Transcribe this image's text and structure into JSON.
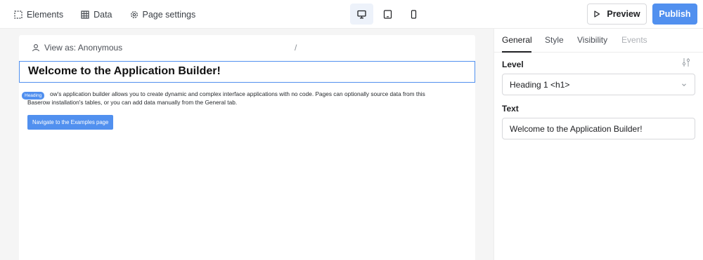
{
  "toolbar": {
    "elements_label": "Elements",
    "data_label": "Data",
    "page_settings_label": "Page settings",
    "preview_label": "Preview",
    "publish_label": "Publish"
  },
  "devices": [
    {
      "name": "desktop",
      "active": true
    },
    {
      "name": "tablet",
      "active": false
    },
    {
      "name": "smartphone",
      "active": false
    }
  ],
  "page": {
    "view_as_label": "View as: Anonymous",
    "path": "/",
    "heading": "Welcome to the Application Builder!",
    "heading_badge": "Heading",
    "paragraph_line1": "ow's application builder allows you to create dynamic and complex interface applications with no code. Pages can optionally source data from this",
    "paragraph_line2": "Baserow installation's tables, or you can add data manually from the General tab.",
    "button_label": "Navigate to the Examples page"
  },
  "panel": {
    "tabs": [
      "General",
      "Style",
      "Visibility",
      "Events"
    ],
    "active_tab": "General",
    "level_label": "Level",
    "level_value": "Heading 1 <h1>",
    "text_label": "Text",
    "text_value": "Welcome to the Application Builder!"
  },
  "colors": {
    "accent": "#5190ef",
    "canvas_bg": "#f5f5f5"
  }
}
